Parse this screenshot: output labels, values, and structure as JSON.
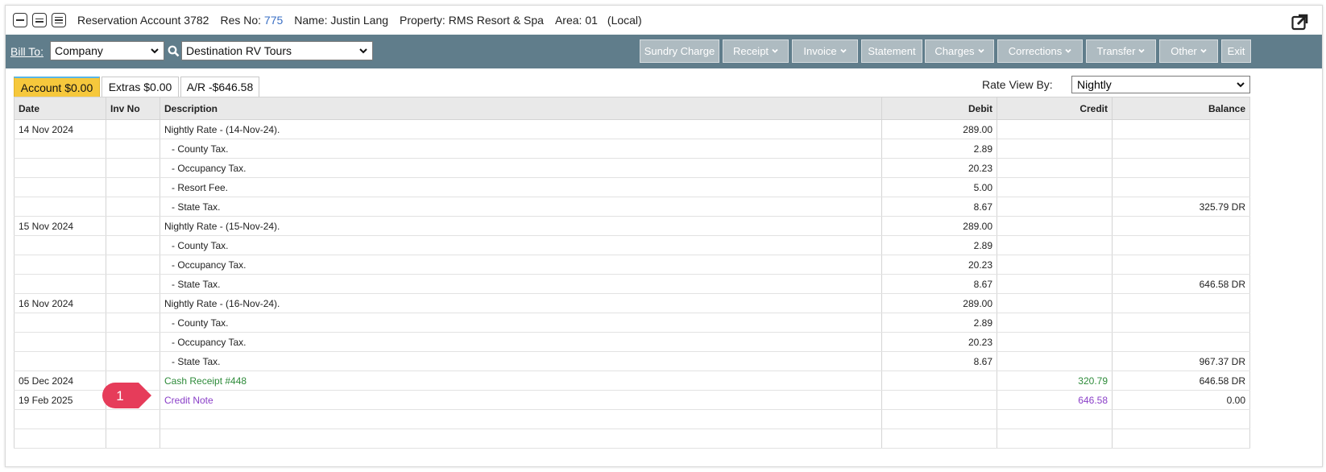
{
  "title": {
    "reservation_account": "Reservation Account 3782",
    "res_no_label": "Res No:",
    "res_no": "775",
    "name": "Name: Justin Lang",
    "property": "Property: RMS Resort & Spa",
    "area": "Area: 01",
    "local": "(Local)"
  },
  "toolbar": {
    "bill_to_label": "Bill To:",
    "bill_to_type": "Company",
    "bill_to_company": "Destination RV Tours",
    "buttons": {
      "sundry_charge": "Sundry Charge",
      "receipt": "Receipt",
      "invoice": "Invoice",
      "statement": "Statement",
      "charges": "Charges",
      "corrections": "Corrections",
      "transfer": "Transfer",
      "other": "Other",
      "exit": "Exit"
    }
  },
  "tabs": {
    "account": "Account $0.00",
    "extras": "Extras $0.00",
    "ar": "A/R -$646.58"
  },
  "rate_view": {
    "label": "Rate View By:",
    "value": "Nightly"
  },
  "table": {
    "headers": {
      "date": "Date",
      "inv_no": "Inv No",
      "description": "Description",
      "debit": "Debit",
      "credit": "Credit",
      "balance": "Balance"
    },
    "rows": [
      {
        "date": "14 Nov 2024",
        "inv": "",
        "desc": "Nightly Rate - (14-Nov-24).",
        "debit": "289.00",
        "credit": "",
        "balance": ""
      },
      {
        "date": "",
        "inv": "",
        "desc": "- County Tax.",
        "debit": "2.89",
        "credit": "",
        "balance": ""
      },
      {
        "date": "",
        "inv": "",
        "desc": "- Occupancy Tax.",
        "debit": "20.23",
        "credit": "",
        "balance": ""
      },
      {
        "date": "",
        "inv": "",
        "desc": "- Resort Fee.",
        "debit": "5.00",
        "credit": "",
        "balance": ""
      },
      {
        "date": "",
        "inv": "",
        "desc": "- State Tax.",
        "debit": "8.67",
        "credit": "",
        "balance": "325.79 DR"
      },
      {
        "date": "15 Nov 2024",
        "inv": "",
        "desc": "Nightly Rate - (15-Nov-24).",
        "debit": "289.00",
        "credit": "",
        "balance": ""
      },
      {
        "date": "",
        "inv": "",
        "desc": "- County Tax.",
        "debit": "2.89",
        "credit": "",
        "balance": ""
      },
      {
        "date": "",
        "inv": "",
        "desc": "- Occupancy Tax.",
        "debit": "20.23",
        "credit": "",
        "balance": ""
      },
      {
        "date": "",
        "inv": "",
        "desc": "- State Tax.",
        "debit": "8.67",
        "credit": "",
        "balance": "646.58 DR"
      },
      {
        "date": "16 Nov 2024",
        "inv": "",
        "desc": "Nightly Rate - (16-Nov-24).",
        "debit": "289.00",
        "credit": "",
        "balance": ""
      },
      {
        "date": "",
        "inv": "",
        "desc": "- County Tax.",
        "debit": "2.89",
        "credit": "",
        "balance": ""
      },
      {
        "date": "",
        "inv": "",
        "desc": "- Occupancy Tax.",
        "debit": "20.23",
        "credit": "",
        "balance": ""
      },
      {
        "date": "",
        "inv": "",
        "desc": "- State Tax.",
        "debit": "8.67",
        "credit": "",
        "balance": "967.37 DR"
      },
      {
        "date": "05 Dec 2024",
        "inv": "",
        "desc": "Cash Receipt #448",
        "debit": "",
        "credit": "320.79",
        "balance": "646.58 DR",
        "style": "green"
      },
      {
        "date": "19 Feb 2025",
        "inv": "",
        "desc": "Credit Note",
        "debit": "",
        "credit": "646.58",
        "balance": "0.00",
        "style": "purple"
      },
      {
        "date": "",
        "inv": "",
        "desc": "",
        "debit": "",
        "credit": "",
        "balance": ""
      },
      {
        "date": "",
        "inv": "",
        "desc": "",
        "debit": "",
        "credit": "",
        "balance": ""
      }
    ]
  },
  "callout": {
    "number": "1",
    "color": "#e63c5a"
  },
  "colors": {
    "toolbar": "#607d8b",
    "active_tab": "#f6c83c",
    "receipt_text": "#2e8b3a",
    "credit_note_text": "#8a3ec8",
    "res_no": "#3a6fc4"
  }
}
